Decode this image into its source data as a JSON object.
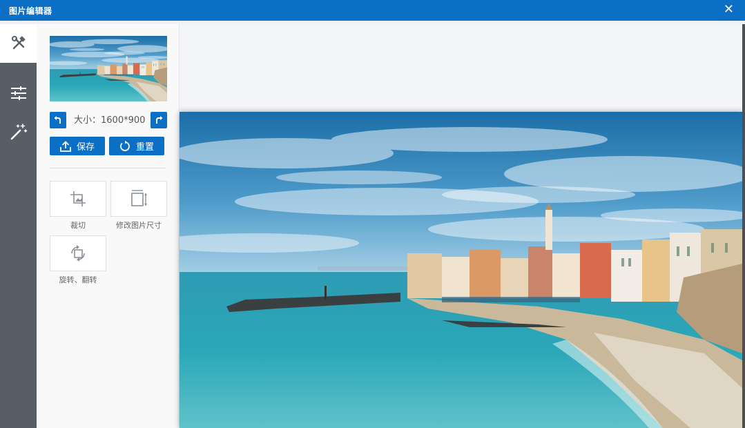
{
  "window": {
    "title": "图片编辑器",
    "close_glyph": "✕"
  },
  "sidebar": {
    "items": [
      {
        "icon": "tools-icon",
        "active": true
      },
      {
        "icon": "sliders-icon",
        "active": false
      },
      {
        "icon": "magic-wand-icon",
        "active": false
      }
    ]
  },
  "panel": {
    "size_text": "大小：1600*900",
    "save_label": "保存",
    "reset_label": "重置",
    "tools": [
      {
        "icon": "crop-icon",
        "label": "裁切"
      },
      {
        "icon": "resize-icon",
        "label": "修改图片尺寸"
      },
      {
        "icon": "rotate-icon",
        "label": "旋转、翻转"
      }
    ]
  },
  "colors": {
    "accent": "#0b6fc6",
    "rail": "#585e66",
    "canvas": "#f4f5f8"
  }
}
